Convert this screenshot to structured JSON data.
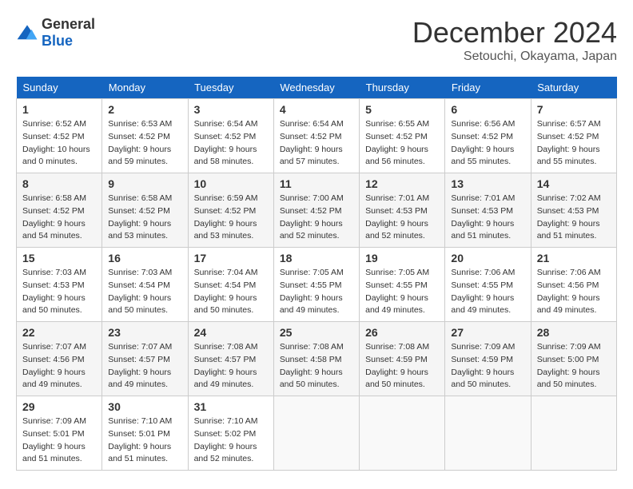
{
  "header": {
    "logo_general": "General",
    "logo_blue": "Blue",
    "month": "December 2024",
    "location": "Setouchi, Okayama, Japan"
  },
  "calendar": {
    "days_of_week": [
      "Sunday",
      "Monday",
      "Tuesday",
      "Wednesday",
      "Thursday",
      "Friday",
      "Saturday"
    ],
    "weeks": [
      [
        null,
        null,
        null,
        null,
        null,
        null,
        null
      ]
    ]
  },
  "days": {
    "1": {
      "sunrise": "6:52 AM",
      "sunset": "4:52 PM",
      "daylight": "10 hours and 0 minutes."
    },
    "2": {
      "sunrise": "6:53 AM",
      "sunset": "4:52 PM",
      "daylight": "9 hours and 59 minutes."
    },
    "3": {
      "sunrise": "6:54 AM",
      "sunset": "4:52 PM",
      "daylight": "9 hours and 58 minutes."
    },
    "4": {
      "sunrise": "6:54 AM",
      "sunset": "4:52 PM",
      "daylight": "9 hours and 57 minutes."
    },
    "5": {
      "sunrise": "6:55 AM",
      "sunset": "4:52 PM",
      "daylight": "9 hours and 56 minutes."
    },
    "6": {
      "sunrise": "6:56 AM",
      "sunset": "4:52 PM",
      "daylight": "9 hours and 55 minutes."
    },
    "7": {
      "sunrise": "6:57 AM",
      "sunset": "4:52 PM",
      "daylight": "9 hours and 55 minutes."
    },
    "8": {
      "sunrise": "6:58 AM",
      "sunset": "4:52 PM",
      "daylight": "9 hours and 54 minutes."
    },
    "9": {
      "sunrise": "6:58 AM",
      "sunset": "4:52 PM",
      "daylight": "9 hours and 53 minutes."
    },
    "10": {
      "sunrise": "6:59 AM",
      "sunset": "4:52 PM",
      "daylight": "9 hours and 53 minutes."
    },
    "11": {
      "sunrise": "7:00 AM",
      "sunset": "4:52 PM",
      "daylight": "9 hours and 52 minutes."
    },
    "12": {
      "sunrise": "7:01 AM",
      "sunset": "4:53 PM",
      "daylight": "9 hours and 52 minutes."
    },
    "13": {
      "sunrise": "7:01 AM",
      "sunset": "4:53 PM",
      "daylight": "9 hours and 51 minutes."
    },
    "14": {
      "sunrise": "7:02 AM",
      "sunset": "4:53 PM",
      "daylight": "9 hours and 51 minutes."
    },
    "15": {
      "sunrise": "7:03 AM",
      "sunset": "4:53 PM",
      "daylight": "9 hours and 50 minutes."
    },
    "16": {
      "sunrise": "7:03 AM",
      "sunset": "4:54 PM",
      "daylight": "9 hours and 50 minutes."
    },
    "17": {
      "sunrise": "7:04 AM",
      "sunset": "4:54 PM",
      "daylight": "9 hours and 50 minutes."
    },
    "18": {
      "sunrise": "7:05 AM",
      "sunset": "4:55 PM",
      "daylight": "9 hours and 49 minutes."
    },
    "19": {
      "sunrise": "7:05 AM",
      "sunset": "4:55 PM",
      "daylight": "9 hours and 49 minutes."
    },
    "20": {
      "sunrise": "7:06 AM",
      "sunset": "4:55 PM",
      "daylight": "9 hours and 49 minutes."
    },
    "21": {
      "sunrise": "7:06 AM",
      "sunset": "4:56 PM",
      "daylight": "9 hours and 49 minutes."
    },
    "22": {
      "sunrise": "7:07 AM",
      "sunset": "4:56 PM",
      "daylight": "9 hours and 49 minutes."
    },
    "23": {
      "sunrise": "7:07 AM",
      "sunset": "4:57 PM",
      "daylight": "9 hours and 49 minutes."
    },
    "24": {
      "sunrise": "7:08 AM",
      "sunset": "4:57 PM",
      "daylight": "9 hours and 49 minutes."
    },
    "25": {
      "sunrise": "7:08 AM",
      "sunset": "4:58 PM",
      "daylight": "9 hours and 50 minutes."
    },
    "26": {
      "sunrise": "7:08 AM",
      "sunset": "4:59 PM",
      "daylight": "9 hours and 50 minutes."
    },
    "27": {
      "sunrise": "7:09 AM",
      "sunset": "4:59 PM",
      "daylight": "9 hours and 50 minutes."
    },
    "28": {
      "sunrise": "7:09 AM",
      "sunset": "5:00 PM",
      "daylight": "9 hours and 50 minutes."
    },
    "29": {
      "sunrise": "7:09 AM",
      "sunset": "5:01 PM",
      "daylight": "9 hours and 51 minutes."
    },
    "30": {
      "sunrise": "7:10 AM",
      "sunset": "5:01 PM",
      "daylight": "9 hours and 51 minutes."
    },
    "31": {
      "sunrise": "7:10 AM",
      "sunset": "5:02 PM",
      "daylight": "9 hours and 52 minutes."
    }
  },
  "labels": {
    "sunrise": "Sunrise:",
    "sunset": "Sunset:",
    "daylight": "Daylight:"
  }
}
